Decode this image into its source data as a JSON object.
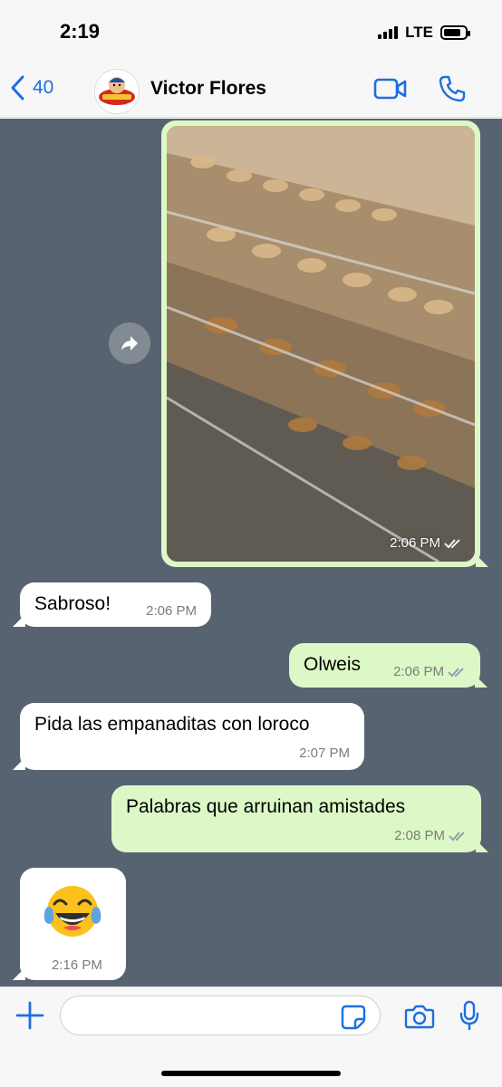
{
  "status_bar": {
    "time": "2:19",
    "network": "LTE",
    "battery_level": 0.8
  },
  "header": {
    "back_count": "40",
    "contact_name": "Victor Flores",
    "icons": [
      "chevron-left-icon",
      "video-camera-icon",
      "phone-icon"
    ]
  },
  "colors": {
    "accent": "#1d6fe0",
    "chat_background": "#586371",
    "outgoing_bubble": "#dcf8c6",
    "incoming_bubble": "#ffffff",
    "read_ticks": "#8a9aa8"
  },
  "messages": [
    {
      "direction": "out",
      "type": "image",
      "time": "2:06 PM",
      "status": "read"
    },
    {
      "direction": "in",
      "type": "text",
      "text": "Sabroso!",
      "time": "2:06 PM"
    },
    {
      "direction": "out",
      "type": "text",
      "text": "Olweis",
      "time": "2:06 PM",
      "status": "read"
    },
    {
      "direction": "in",
      "type": "text",
      "text": "Pida las empanaditas con loroco",
      "time": "2:07 PM"
    },
    {
      "direction": "out",
      "type": "text",
      "text": "Palabras que arruinan amistades",
      "time": "2:08 PM",
      "status": "read"
    },
    {
      "direction": "in",
      "type": "emoji",
      "text": "😂",
      "time": "2:16 PM"
    }
  ],
  "input_bar": {
    "value": "",
    "icons": [
      "plus-icon",
      "sticker-icon",
      "camera-icon",
      "microphone-icon"
    ]
  }
}
